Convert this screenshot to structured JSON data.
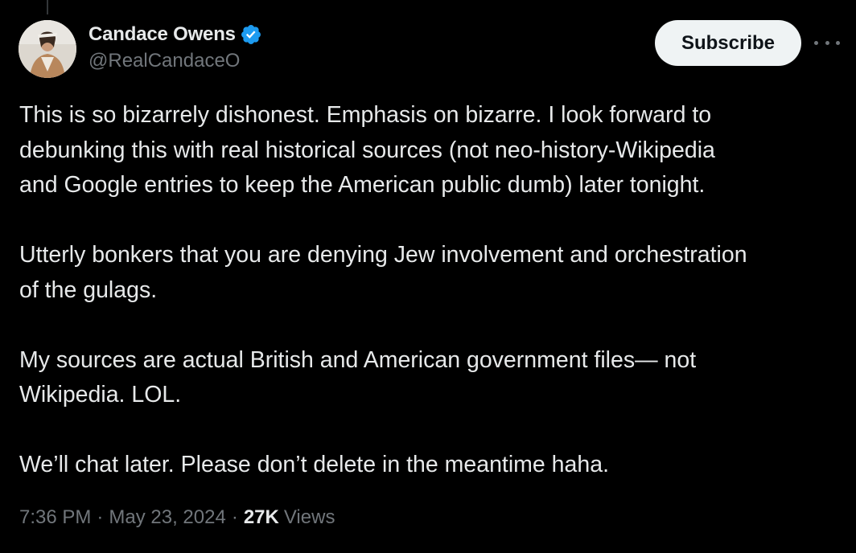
{
  "tweet": {
    "author": {
      "display_name": "Candace Owens",
      "handle": "@RealCandaceO",
      "verified": true,
      "verified_color": "#1d9bf0"
    },
    "subscribe_label": "Subscribe",
    "body": {
      "paragraphs": [
        {
          "lines": [
            "This is so bizarrely dishonest. Emphasis on bizarre.  I look forward to",
            "debunking this with real historical sources (not neo-history-Wikipedia",
            "and Google entries to keep the American public dumb) later tonight."
          ]
        },
        {
          "lines": [
            "Utterly bonkers that you are denying Jew involvement and orchestration",
            "of the gulags."
          ]
        },
        {
          "lines": [
            "My sources are actual British and American government files— not",
            "Wikipedia.  LOL."
          ]
        },
        {
          "lines": [
            "We’ll chat later. Please don’t delete in the meantime haha."
          ]
        }
      ]
    },
    "meta": {
      "time": "7:36 PM",
      "separator": "·",
      "date": "May 23, 2024",
      "views_count": "27K",
      "views_label": "Views"
    }
  },
  "icons": {
    "verified": "verified-badge-icon",
    "more": "more-horizontal-icon"
  },
  "colors": {
    "background": "#000000",
    "text_primary": "#e7e9ea",
    "text_secondary": "#71767b",
    "button_bg": "#eff3f4",
    "button_text": "#0f1419",
    "accent": "#1d9bf0"
  }
}
